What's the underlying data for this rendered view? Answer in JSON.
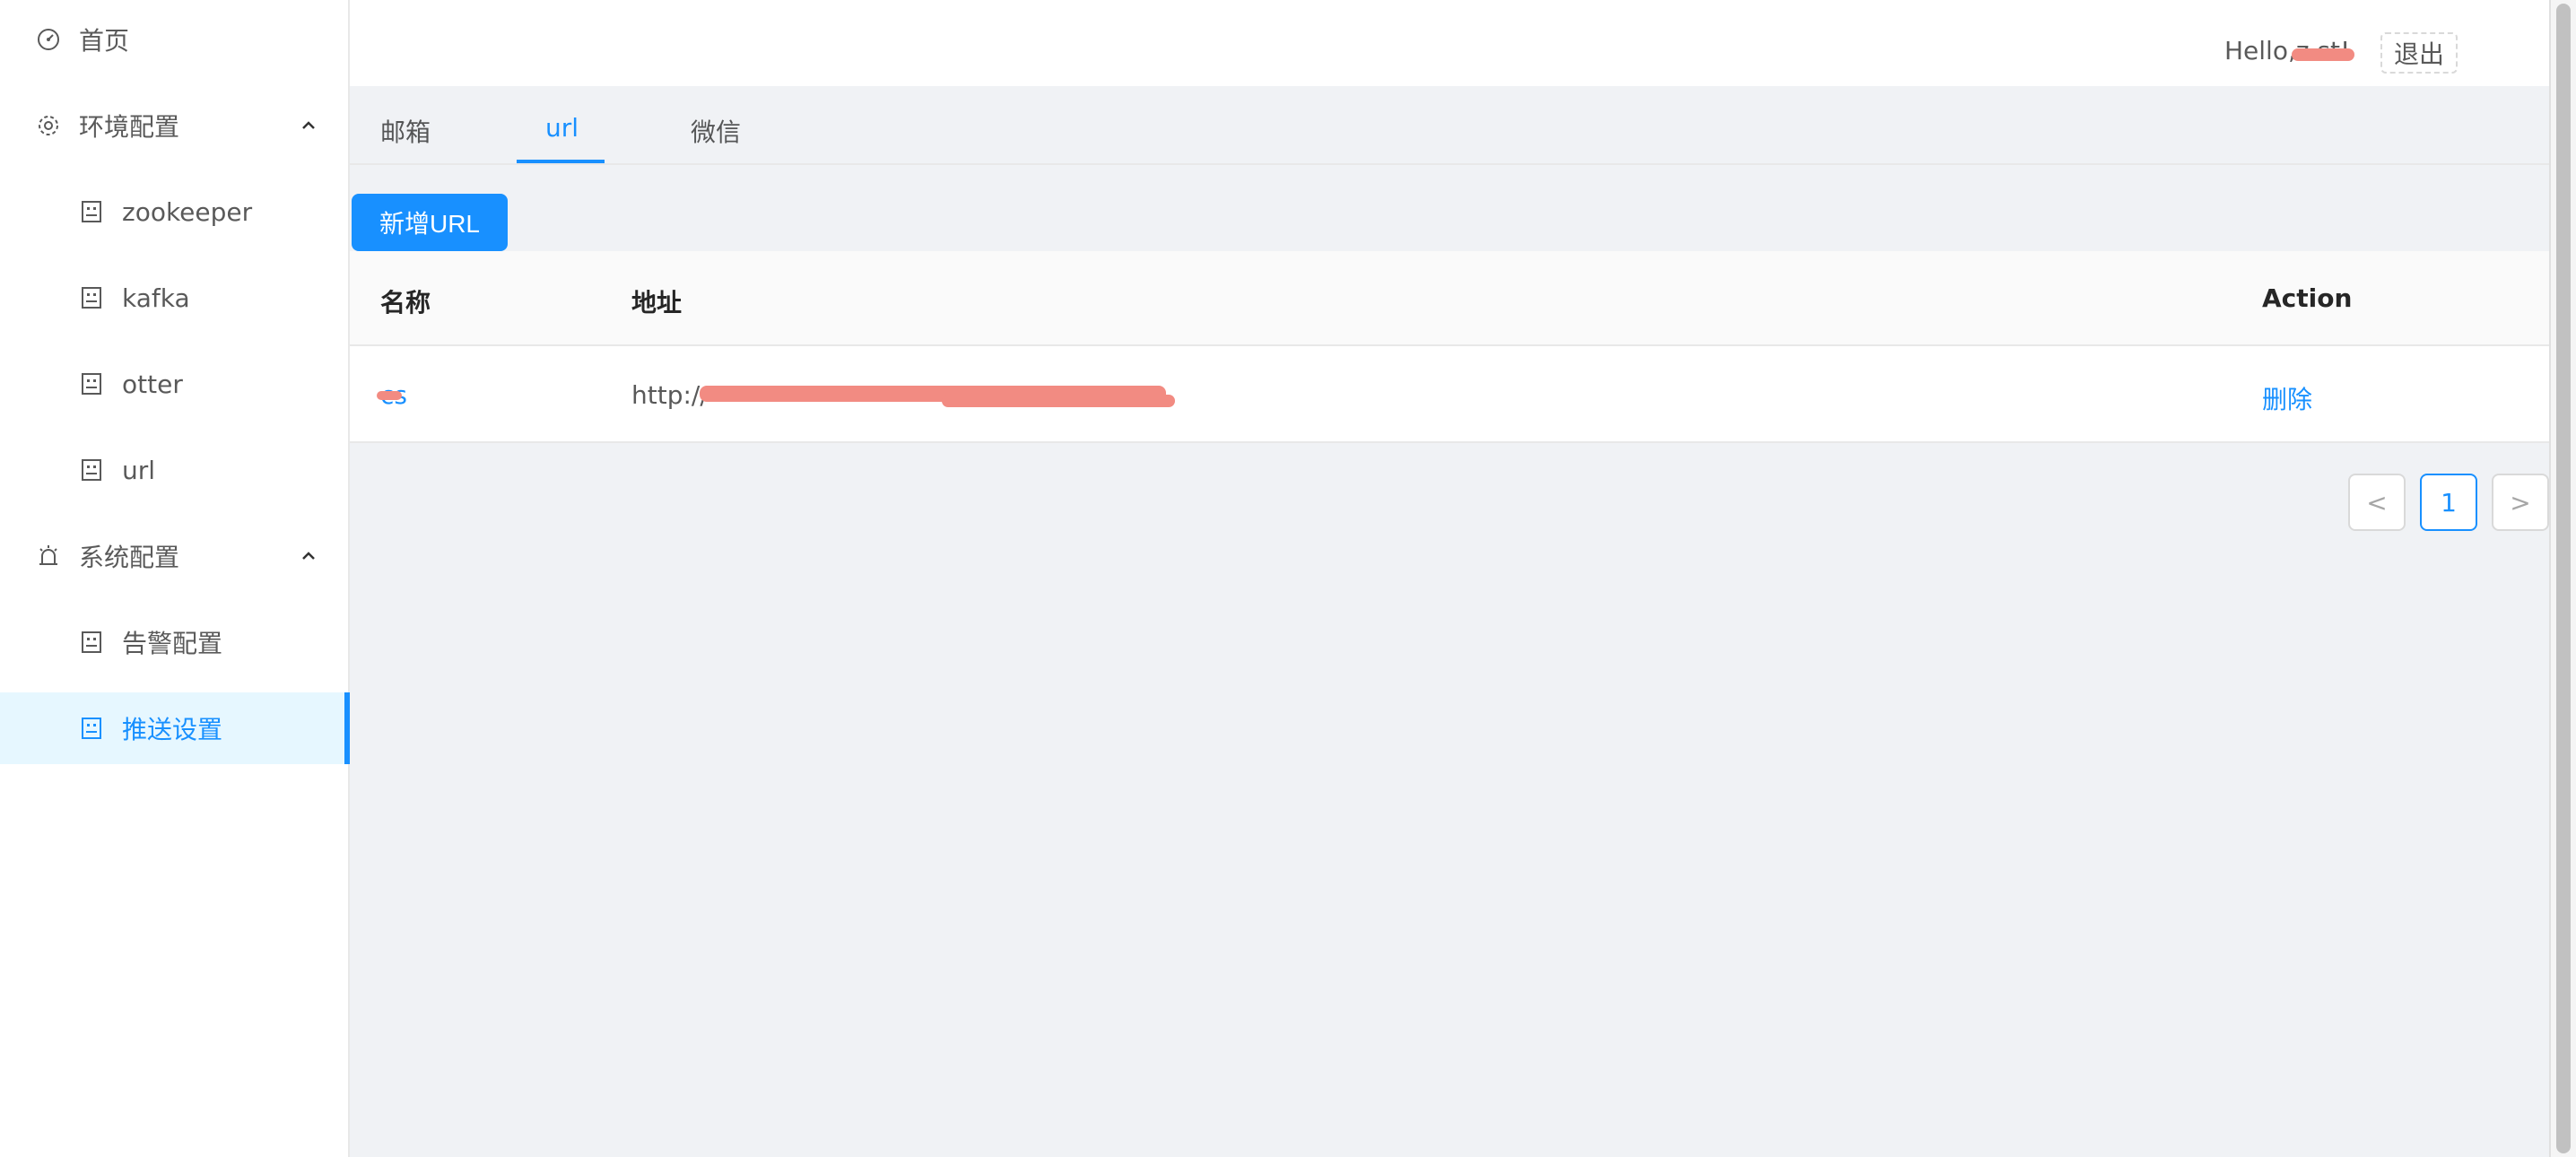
{
  "sidebar": {
    "items": [
      {
        "label": "首页",
        "icon": "dashboard-icon"
      },
      {
        "label": "环境配置",
        "icon": "gear-icon",
        "expanded": true
      },
      {
        "label": "zookeeper",
        "icon": "file-icon"
      },
      {
        "label": "kafka",
        "icon": "file-icon"
      },
      {
        "label": "otter",
        "icon": "file-icon"
      },
      {
        "label": "url",
        "icon": "file-icon"
      },
      {
        "label": "系统配置",
        "icon": "alarm-icon",
        "expanded": true
      },
      {
        "label": "告警配置",
        "icon": "file-icon"
      },
      {
        "label": "推送设置",
        "icon": "file-icon",
        "selected": true
      }
    ]
  },
  "header": {
    "greeting": "Hello,z    st!",
    "logout_label": "退出"
  },
  "tabs": [
    {
      "label": "邮箱"
    },
    {
      "label": "url",
      "active": true
    },
    {
      "label": "微信"
    }
  ],
  "toolbar": {
    "add_label": "新增URL"
  },
  "table": {
    "columns": [
      "名称",
      "地址",
      "Action"
    ],
    "rows": [
      {
        "name": "cs",
        "address": "http://",
        "action": "删除"
      }
    ]
  },
  "pagination": {
    "prev": "<",
    "current": "1",
    "next": ">"
  },
  "colors": {
    "accent": "#1890ff",
    "selected_bg": "#e6f7ff",
    "redaction": "#f28b82"
  }
}
